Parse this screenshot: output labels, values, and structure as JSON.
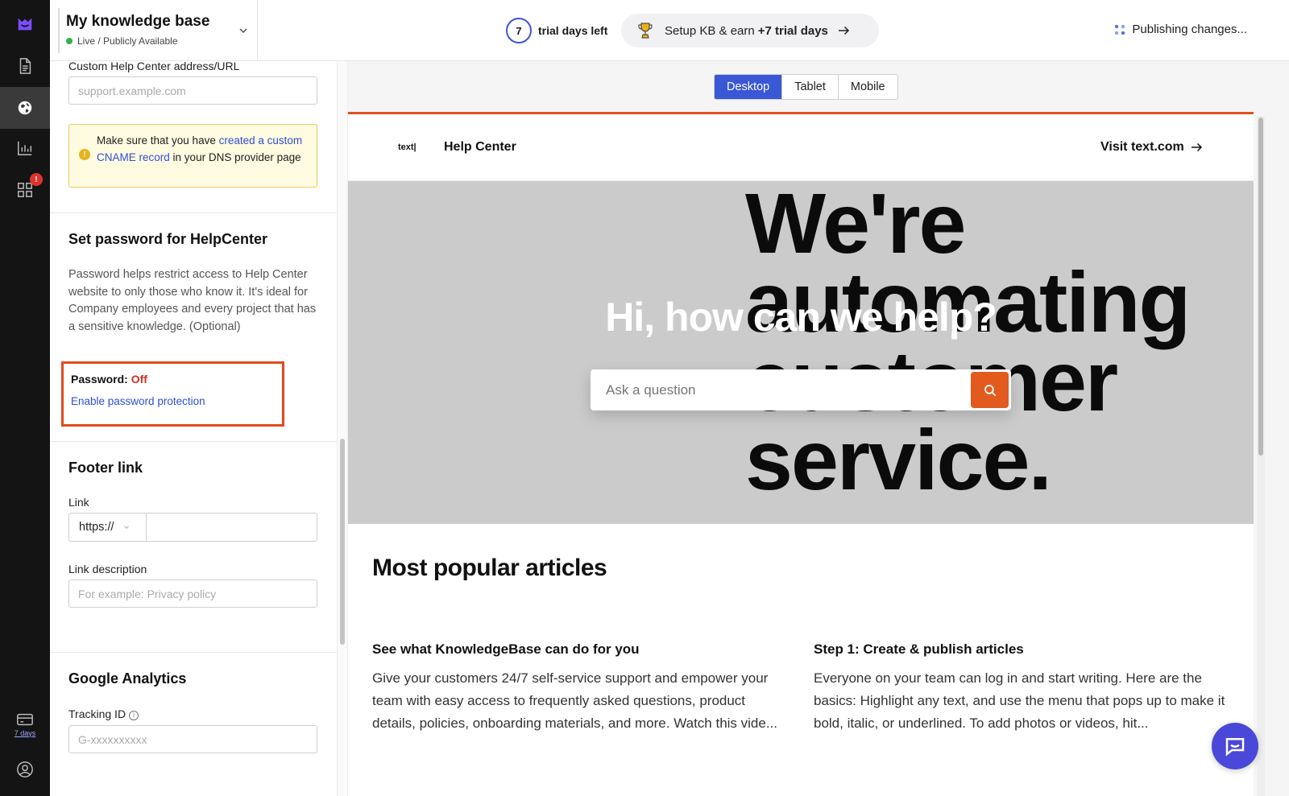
{
  "topbar": {
    "kb_title": "My knowledge base",
    "kb_status": "Live / Publicly Available",
    "trial_days": "7",
    "trial_label": "trial days left",
    "setup_text": "Setup KB & earn",
    "setup_bonus": "+7 trial days",
    "publishing": "Publishing changes..."
  },
  "rail": {
    "alert_badge": "!",
    "billing_label": "7 days"
  },
  "settings": {
    "custom_url_label": "Custom Help Center address/URL",
    "custom_url_placeholder": "support.example.com",
    "warning_pre": "Make sure that you have",
    "warning_link": "created a custom CNAME record",
    "warning_post": "in your DNS provider page",
    "password_section_title": "Set password for HelpCenter",
    "password_desc": "Password helps restrict access to Help Center website to only those who know it. It's ideal for Company employees and every project that has a sensitive knowledge. (Optional)",
    "password_label": "Password:",
    "password_value": "Off",
    "password_link": "Enable password protection",
    "footer_section_title": "Footer link",
    "link_label": "Link",
    "link_protocol": "https://",
    "link_desc_label": "Link description",
    "link_desc_placeholder": "For example: Privacy policy",
    "ga_section_title": "Google Analytics",
    "tracking_label": "Tracking ID",
    "tracking_placeholder": "G-xxxxxxxxxx"
  },
  "preview": {
    "device_tabs": [
      "Desktop",
      "Tablet",
      "Mobile"
    ],
    "active_device": "Desktop",
    "hc_logo": "text|",
    "hc_title": "Help Center",
    "hc_visit": "Visit text.com",
    "hero_bg_lines": [
      "We're",
      "automating",
      "customer",
      "service."
    ],
    "hero_title": "Hi, how can we help?",
    "search_placeholder": "Ask a question",
    "popular_title": "Most popular articles",
    "articles": [
      {
        "title": "See what KnowledgeBase can do for you",
        "body": "Give your customers 24/7 self-service support and empower your team with easy access to frequently asked questions, product details, policies, onboarding materials, and more. Watch this vide..."
      },
      {
        "title": "Step 1: Create & publish articles",
        "body": "Everyone on your team can log in and start writing. Here are the basics: Highlight any text, and use the menu that pops up to make it bold, italic, or underlined. To add photos or videos, hit..."
      }
    ]
  },
  "colors": {
    "accent": "#3a57d6",
    "brand_orange": "#e35a1f",
    "highlight_box": "#e04b1c",
    "status_off": "#d2301f",
    "live_dot": "#2db34a"
  }
}
